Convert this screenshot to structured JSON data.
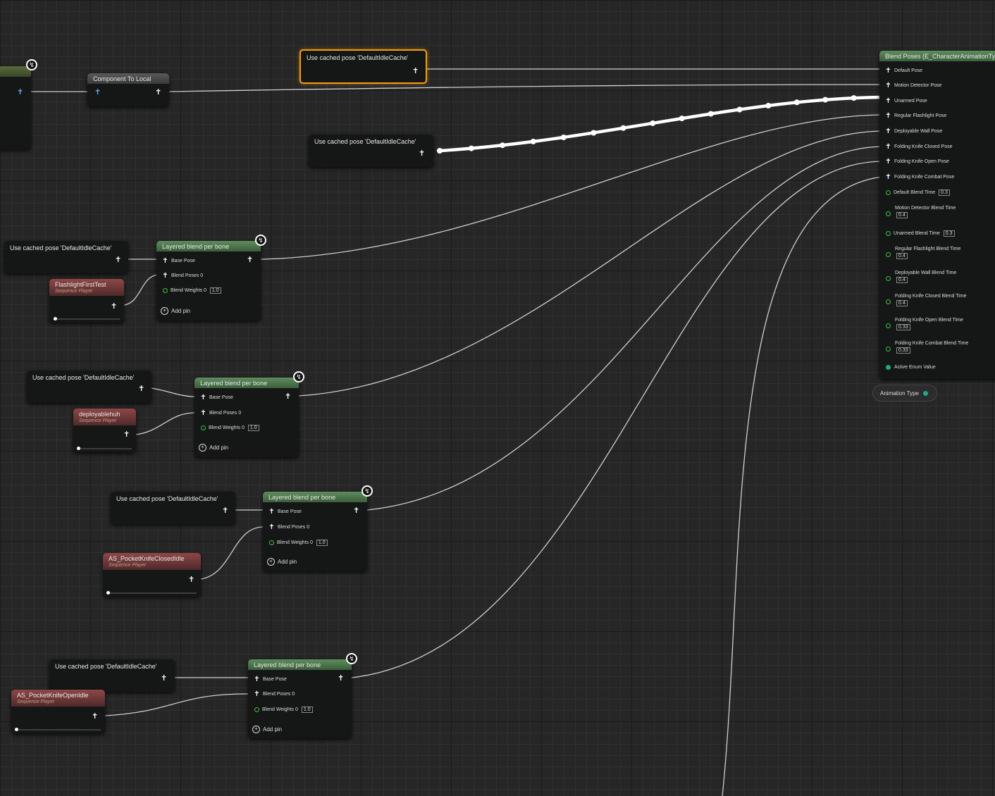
{
  "cached_pose_label": "Use cached pose 'DefaultIdleCache'",
  "component_to_local": "Component To Local",
  "layered_blend": {
    "title": "Layered blend per bone",
    "base_pose": "Base Pose",
    "blend_poses": "Blend Poses 0",
    "blend_weights": "Blend Weights 0",
    "weight_value": "1.0",
    "add_pin": "Add pin"
  },
  "sequence_players": [
    {
      "name": "FlashlightFirstTest",
      "sub": "Sequence Player"
    },
    {
      "name": "deployablehuh",
      "sub": "Sequence Player"
    },
    {
      "name": "AS_PocketKnifeClosedIdle",
      "sub": "Sequence Player"
    },
    {
      "name": "AS_PocketKnifeOpenIdle",
      "sub": "Sequence Player"
    }
  ],
  "blend_poses_enum": {
    "title": "Blend Poses (E_CharacterAnimationTy",
    "pose_pins": [
      "Default Pose",
      "Motion Detector Pose",
      "Unarmed Pose",
      "Regular Flashlight Pose",
      "Deployable Wall Pose",
      "Folding Knife Closed Pose",
      "Folding Knife Open Pose",
      "Folding Knife Combat Pose"
    ],
    "blend_times": [
      {
        "label": "Default Blend Time",
        "value": "0.3"
      },
      {
        "label": "Motion Detector Blend Time",
        "value": "0.4"
      },
      {
        "label": "Unarmed Blend Time",
        "value": "0.3"
      },
      {
        "label": "Regular Flashlight Blend Time",
        "value": "0.4"
      },
      {
        "label": "Deployable Wall Blend Time",
        "value": "0.4"
      },
      {
        "label": "Folding Knife Closed Blend Time",
        "value": "0.4"
      },
      {
        "label": "Folding Knife Open Blend Time",
        "value": "0.33"
      },
      {
        "label": "Folding Knife Combat Blend Time",
        "value": "0.33"
      }
    ],
    "active_enum": "Active Enum Value"
  },
  "animation_type_variable": "Animation Type",
  "icons": {
    "pose_pin": "pose-pin-icon",
    "float_pin": "float-pin-icon",
    "fast_path": "fast-path-lightning-icon",
    "add_pin": "add-pin-icon"
  },
  "colors": {
    "background": "#262626",
    "node_body": "#151716",
    "blend_header": "#4a764a",
    "sequence_header": "#7a3c3c",
    "selection": "#f39c12",
    "float_pin": "#3fbf3f",
    "enum_pin": "#1fa88a"
  }
}
